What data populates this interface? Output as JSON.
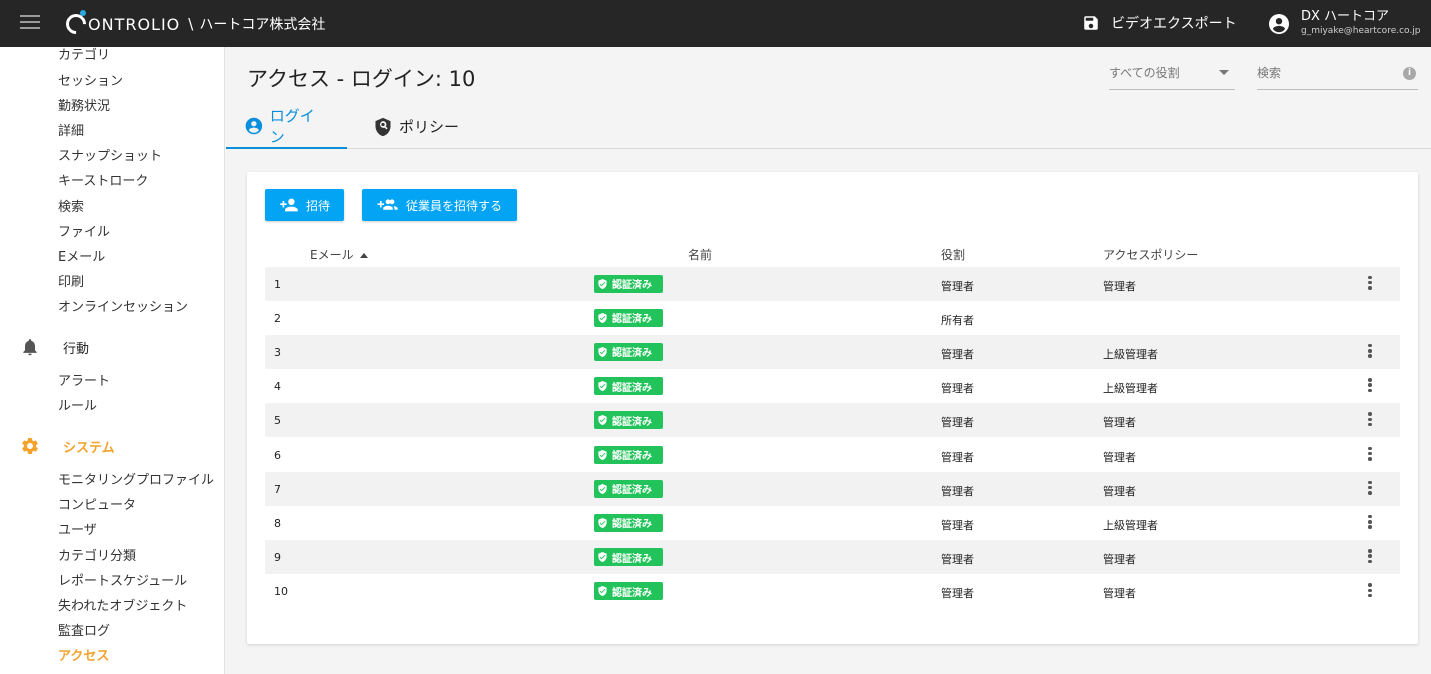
{
  "header": {
    "logo_text": "ONTROLIO",
    "separator": "\\",
    "company": "ハートコア株式会社",
    "video_export": "ビデオエクスポート",
    "user_name": "DX ハートコア",
    "user_email": "g_miyake@heartcore.co.jp"
  },
  "sidebar": {
    "report_items": [
      "カテゴリ",
      "セッション",
      "勤務状況",
      "詳細",
      "スナップショット",
      "キーストローク",
      "検索",
      "ファイル",
      "Eメール",
      "印刷",
      "オンラインセッション"
    ],
    "behavior_label": "行動",
    "behavior_items": [
      "アラート",
      "ルール"
    ],
    "system_label": "システム",
    "system_items": [
      "モニタリングプロファイル",
      "コンピュータ",
      "ユーザ",
      "カテゴリ分類",
      "レポートスケジュール",
      "失われたオブジェクト",
      "監査ログ",
      "アクセス"
    ],
    "active_item": "アクセス",
    "accent_color": "#f3a22c"
  },
  "main": {
    "title": "アクセス - ログイン: 10",
    "role_filter": "すべての役割",
    "search_placeholder": "検索",
    "tabs": [
      {
        "label": "ログイン",
        "active": true
      },
      {
        "label": "ポリシー",
        "active": false
      }
    ],
    "buttons": {
      "invite": "招待",
      "invite_employee": "従業員を招待する"
    },
    "table": {
      "columns": [
        "Eメール",
        "名前",
        "役割",
        "アクセスポリシー"
      ],
      "sort_column": "Eメール",
      "badge_label": "認証済み",
      "rows": [
        {
          "num": "1",
          "role": "管理者",
          "policy": "管理者",
          "menu": true
        },
        {
          "num": "2",
          "role": "所有者",
          "policy": "",
          "menu": false
        },
        {
          "num": "3",
          "role": "管理者",
          "policy": "上級管理者",
          "menu": true
        },
        {
          "num": "4",
          "role": "管理者",
          "policy": "上級管理者",
          "menu": true
        },
        {
          "num": "5",
          "role": "管理者",
          "policy": "管理者",
          "menu": true
        },
        {
          "num": "6",
          "role": "管理者",
          "policy": "管理者",
          "menu": true
        },
        {
          "num": "7",
          "role": "管理者",
          "policy": "管理者",
          "menu": true
        },
        {
          "num": "8",
          "role": "管理者",
          "policy": "上級管理者",
          "menu": true
        },
        {
          "num": "9",
          "role": "管理者",
          "policy": "管理者",
          "menu": true
        },
        {
          "num": "10",
          "role": "管理者",
          "policy": "管理者",
          "menu": true
        }
      ]
    }
  },
  "colors": {
    "topbar": "#262626",
    "primary": "#03a4f4",
    "tab_active": "#0a8fdc",
    "verified": "#22c35a"
  }
}
